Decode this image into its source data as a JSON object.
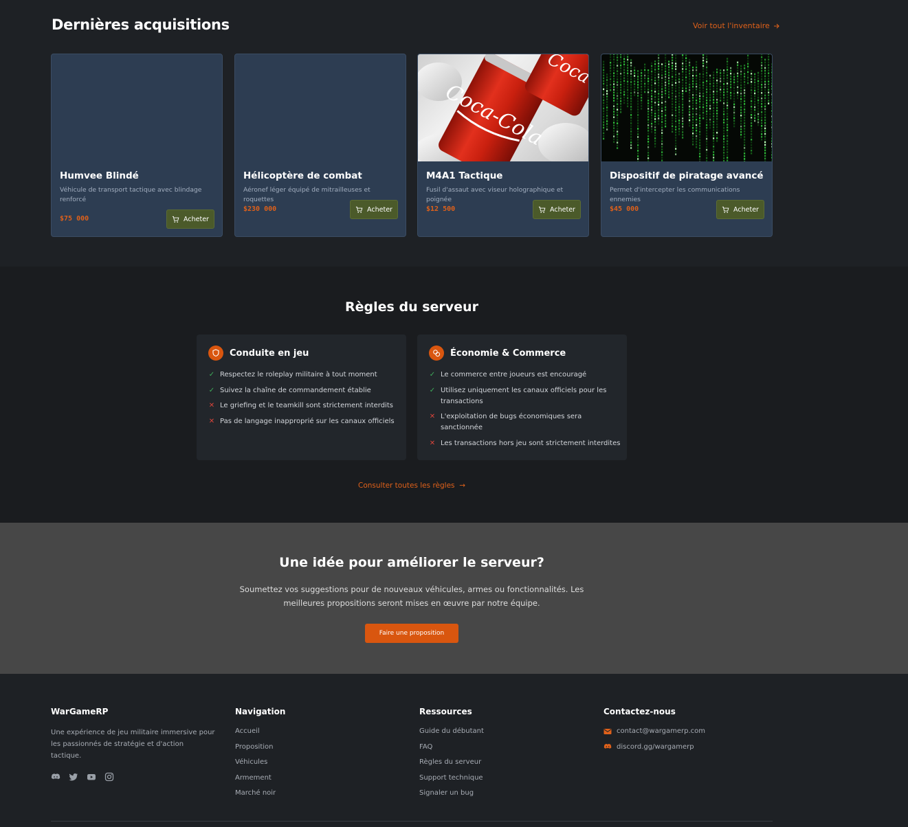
{
  "acquisitions": {
    "title": "Dernières acquisitions",
    "view_all": "Voir tout l'inventaire",
    "items": [
      {
        "name": "Humvee Blindé",
        "description": "Véhicule de transport tactique avec blindage renforcé",
        "price": "$75 000",
        "buy_label": "Acheter",
        "image": "none"
      },
      {
        "name": "Hélicoptère de combat",
        "description": "Aéronef léger équipé de mitrailleuses et roquettes",
        "price": "$230 000",
        "buy_label": "Acheter",
        "image": "none"
      },
      {
        "name": "M4A1 Tactique",
        "description": "Fusil d'assaut avec viseur holographique et poignée",
        "price": "$12 500",
        "buy_label": "Acheter",
        "image": "coca-cola-cans-photo"
      },
      {
        "name": "Dispositif de piratage avancé",
        "description": "Permet d'intercepter les communications ennemies",
        "price": "$45 000",
        "buy_label": "Acheter",
        "image": "matrix-code-photo"
      }
    ]
  },
  "rules": {
    "title": "Règles du serveur",
    "cards": [
      {
        "icon": "shield-icon",
        "title": "Conduite en jeu",
        "items": [
          {
            "type": "allowed",
            "text": "Respectez le roleplay militaire à tout moment"
          },
          {
            "type": "allowed",
            "text": "Suivez la chaîne de commandement établie"
          },
          {
            "type": "forbidden",
            "text": "Le griefing et le teamkill sont strictement interdits"
          },
          {
            "type": "forbidden",
            "text": "Pas de langage inapproprié sur les canaux officiels"
          }
        ]
      },
      {
        "icon": "coins-icon",
        "title": "Économie & Commerce",
        "items": [
          {
            "type": "allowed",
            "text": "Le commerce entre joueurs est encouragé"
          },
          {
            "type": "allowed",
            "text": "Utilisez uniquement les canaux officiels pour les transactions"
          },
          {
            "type": "forbidden",
            "text": "L'exploitation de bugs économiques sera sanctionnée"
          },
          {
            "type": "forbidden",
            "text": "Les transactions hors jeu sont strictement interdites"
          }
        ]
      }
    ],
    "view_all": "Consulter toutes les règles"
  },
  "idea": {
    "title": "Une idée pour améliorer le serveur?",
    "text": "Soumettez vos suggestions pour de nouveaux véhicules, armes ou fonctionnalités. Les meilleures propositions seront mises en œuvre par notre équipe.",
    "button": "Faire une proposition"
  },
  "footer": {
    "brand": "WarGameRP",
    "about": "Une expérience de jeu militaire immersive pour les passionnés de stratégie et d'action tactique.",
    "social": [
      "discord-icon",
      "twitter-icon",
      "youtube-icon",
      "instagram-icon"
    ],
    "navigation": {
      "title": "Navigation",
      "links": [
        "Accueil",
        "Proposition",
        "Véhicules",
        "Armement",
        "Marché noir"
      ]
    },
    "resources": {
      "title": "Ressources",
      "links": [
        "Guide du débutant",
        "FAQ",
        "Règles du serveur",
        "Support technique",
        "Signaler un bug"
      ]
    },
    "contact": {
      "title": "Contactez-nous",
      "email": "contact@wargamerp.com",
      "discord": "discord.gg/wargamerp"
    }
  },
  "colors": {
    "accent": "#e0611a",
    "buy_button": "#4b5a2a",
    "card_bg": "#2d3d52",
    "page_bg": "#1e2125"
  }
}
